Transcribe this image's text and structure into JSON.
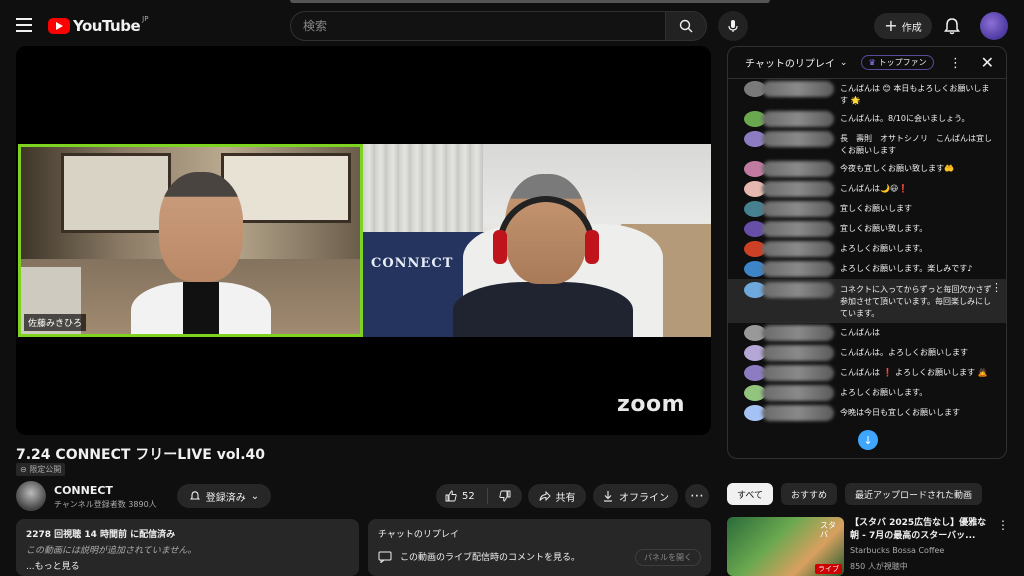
{
  "header": {
    "logo_text": "YouTube",
    "logo_region": "JP",
    "search_placeholder": "検索",
    "create_label": "作成",
    "colors": {
      "brand": "#ff0000",
      "bg": "#0f0f0f"
    }
  },
  "video": {
    "left_name_tag": "佐藤みきひろ",
    "bed_text": "CONNECT",
    "zoom_watermark": "zoom",
    "title": "7.24 CONNECT フリーLIVE vol.40",
    "visibility": "限定公開"
  },
  "channel": {
    "name": "CONNECT",
    "subscribers": "チャンネル登録者数 3890人",
    "subscribed_label": "登録済み"
  },
  "actions": {
    "like_count": "52",
    "share_label": "共有",
    "offline_label": "オフライン"
  },
  "description": {
    "stats": "2278 回視聴  14 時間前 に配信済み",
    "empty_text": "この動画には説明が追加されていません。",
    "more_label": "...もっと見る"
  },
  "chat_replay_box": {
    "header": "チャットのリプレイ",
    "text": "この動画のライブ配信時のコメントを見る。",
    "open_panel_label": "パネルを開く"
  },
  "chat": {
    "header_label": "チャットのリプレイ",
    "top_fan_label": "トップファン",
    "messages": [
      {
        "text": "こんばんは 😊 本日もよろしくお願いします 🌟",
        "color": "#7a7a7a"
      },
      {
        "text": "こんばんは。8/10に会いましょう。",
        "color": "#6aa84f"
      },
      {
        "text": "長　壽則　オサトシノリ　こんばんは宜しくお願いします",
        "color": "#8e7cc3"
      },
      {
        "text": "今夜も宜しくお願い致します🤲",
        "color": "#c27ba0"
      },
      {
        "text": "こんばんは🌙😃❗",
        "color": "#e6b8af"
      },
      {
        "text": "宜しくお願いします",
        "color": "#45818e"
      },
      {
        "text": "宜しくお願い致します。",
        "color": "#674ea7"
      },
      {
        "text": "よろしくお願いします。",
        "color": "#cc4125"
      },
      {
        "text": "よろしくお願いします。楽しみです♪",
        "color": "#3d85c6"
      },
      {
        "text": "コネクトに入ってからずっと毎回欠かさず参加させて頂いています。毎回楽しみにしています。",
        "color": "#6fa8dc"
      },
      {
        "text": "こんばんは",
        "color": "#999999"
      },
      {
        "text": "こんばんは。よろしくお願いします",
        "color": "#b4a7d6"
      },
      {
        "text": "こんばんは ❗ よろしくお願いします 🙇",
        "color": "#8e7cc3"
      },
      {
        "text": "よろしくお願いします。",
        "color": "#93c47d"
      },
      {
        "text": "今晩は今日も宜しくお願いします",
        "color": "#a4c2f4"
      }
    ]
  },
  "related": {
    "chips": [
      "すべて",
      "おすすめ",
      "最近アップロードされた動画"
    ],
    "item": {
      "title": "【スタバ 2025広告なし】優雅な朝 - 7月の最高のスターバッ...",
      "channel": "Starbucks Bossa Coffee",
      "viewers": "850 人が視聴中",
      "thumb_overlay": "スタバ",
      "live_badge": "ライブ"
    }
  }
}
